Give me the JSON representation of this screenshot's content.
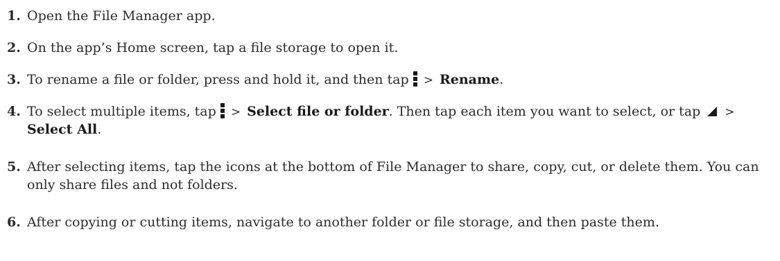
{
  "steps": [
    {
      "number": "1.",
      "text": "Open the File Manager app."
    },
    {
      "number": "2.",
      "text": "On the app’s Home screen, tap a file storage to open it."
    },
    {
      "number": "3.",
      "text_before": "To rename a file or folder, press and hold it, and then tap",
      "separator": ">",
      "bold": "Rename",
      "text_after": ".",
      "icon": "more-options-icon"
    },
    {
      "number": "4.",
      "text_before": "To select multiple items, tap",
      "separator": ">",
      "bold": "Select file or folder",
      "text_middle": ". Then tap each item you want to select, or tap",
      "icon1": "more-options-icon",
      "icon2": "select-all-corner-icon",
      "separator2": ">",
      "bold2": "Select All",
      "text_after": "."
    },
    {
      "number": "5.",
      "text": "After selecting items, tap the icons at the bottom of File Manager to share, copy, cut, or delete them. You can only share files and not folders."
    },
    {
      "number": "6.",
      "text": "After copying or cutting items, navigate to another folder or file storage, and then paste them."
    }
  ],
  "colors": {
    "text": "#2b2b2b",
    "icon": "#1a1a1a"
  }
}
